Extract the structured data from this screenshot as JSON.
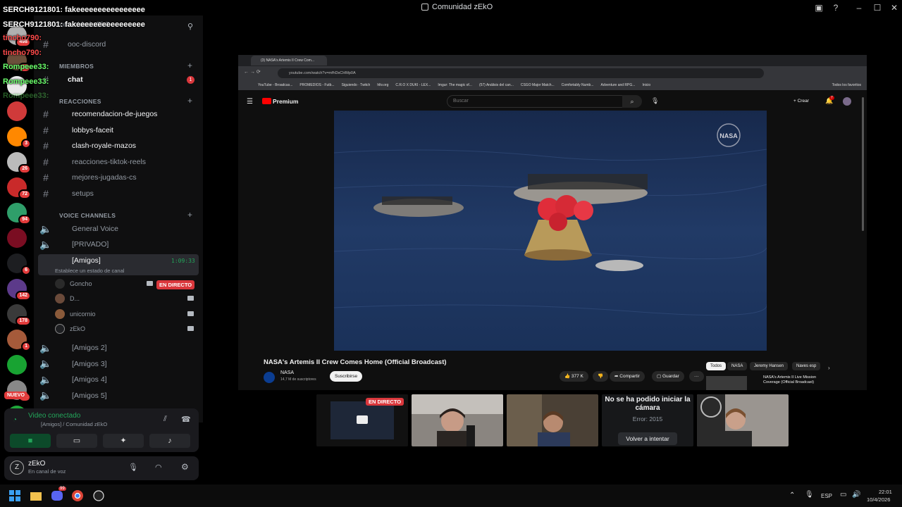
{
  "window": {
    "title": "Comunidad zEkO"
  },
  "chat_overlay": [
    "SERCH9121801: fakeeeeeeeeeeeeeeee",
    "SERCH9121801: fakeeeeeeeeeeeeeeee",
    "tincho790:",
    "tincho790:",
    "Rompeee33:",
    "Rompeee33:",
    "Rompeee33:"
  ],
  "servers": [
    {
      "color": "#b0b0b0",
      "badge": "498"
    },
    {
      "color": "#6b4f3b",
      "badge": "26"
    },
    {
      "color": "#e9e9e9",
      "badge": ""
    },
    {
      "color": "#d03a3a",
      "badge": ""
    },
    {
      "color": "#ff8800",
      "badge": "3"
    },
    {
      "color": "#bbbbbb",
      "badge": "26"
    },
    {
      "color": "#c92a2a",
      "badge": "72"
    },
    {
      "color": "#2f9e6a",
      "badge": "94"
    },
    {
      "color": "#7a0d22",
      "badge": ""
    },
    {
      "color": "#1d1e21",
      "badge": "6"
    },
    {
      "color": "#5c3a8a",
      "badge": "142"
    },
    {
      "color": "#3a3a3a",
      "badge": "178"
    },
    {
      "color": "#a55a3a",
      "badge": "1"
    },
    {
      "color": "#18a332",
      "badge": ""
    },
    {
      "color": "#888888",
      "badge": "32"
    },
    {
      "color": "#1fa83a",
      "badge": ""
    },
    {
      "color": "#c2263f",
      "badge": ""
    }
  ],
  "new_label": "NUEVO",
  "sidebar": {
    "server_name": "Comunidad zEkO",
    "ooc": "ooc-discord",
    "cat_members": "MIEMBROS",
    "chat": "chat",
    "chat_badge": "1",
    "cat_reactions": "REACCIONES",
    "channels": [
      "recomendacion-de-juegos",
      "lobbys-faceit",
      "clash-royale-mazos",
      "reacciones-tiktok-reels",
      "mejores-jugadas-cs",
      "setups"
    ],
    "cat_voice": "VOICE CHANNELS",
    "voice": [
      "General Voice",
      "[PRIVADO]"
    ],
    "active_voice": "[Amigos]",
    "active_time": "1:09:33",
    "active_status": "Establece un estado de canal",
    "users": [
      "Goncho",
      "D...",
      "unicornio",
      "zEkO"
    ],
    "live_label": "EN DIRECTO",
    "more_voice": [
      "[Amigos 2]",
      "[Amigos 3]",
      "[Amigos 4]",
      "[Amigos 5]"
    ]
  },
  "voice_panel": {
    "status": "Video conectado",
    "channel": "[Amigos] / Comunidad zEkO"
  },
  "user_panel": {
    "name": "zEkO",
    "status": "En canal de voz"
  },
  "browser": {
    "tab_title": "(3) NASA's Artemis II Crew Com...",
    "url": "youtube.com/watch?v=mfhDsCHMp0A",
    "bookmarks": [
      "YouTube - Broadcas...",
      "PROMEDIOS - Futb...",
      "Siguiendo · Twitch",
      "hltv.org",
      "C.R.O X DUKI - LEX...",
      "Imgur: The magic of...",
      "(57) Análisis del can...",
      "CSGO Major Match...",
      "Comfortably Numb...",
      "Adventure and RPG...",
      "Inicio"
    ],
    "all_bookmarks": "Todos los favoritos",
    "yt_brand": "Premium",
    "search_placeholder": "Buscar",
    "create": "Crear",
    "notif": "7",
    "nasa_mark": "NASA",
    "video_title": "NASA's Artemis II Crew Comes Home (Official Broadcast)",
    "channel": "NASA",
    "subs": "14,7 M de suscriptores",
    "subscribe": "Suscribirse",
    "likes": "377 K",
    "share": "Compartir",
    "save": "Guardar",
    "chips": [
      "Todos",
      "NASA",
      "Jeremy Hansen",
      "Naves esp"
    ],
    "rec_title": "NASA's Artemis II Live Mission Coverage (Official Broadcast)"
  },
  "tiles": {
    "live": "EN DIRECTO",
    "error_title": "No se ha podido iniciar la cámara",
    "error_code": "Error: 2015",
    "retry": "Volver a intentar"
  },
  "taskbar": {
    "discord_badge": "99",
    "lang": "ESP",
    "time": "22:01",
    "date": "10/4/2026"
  }
}
